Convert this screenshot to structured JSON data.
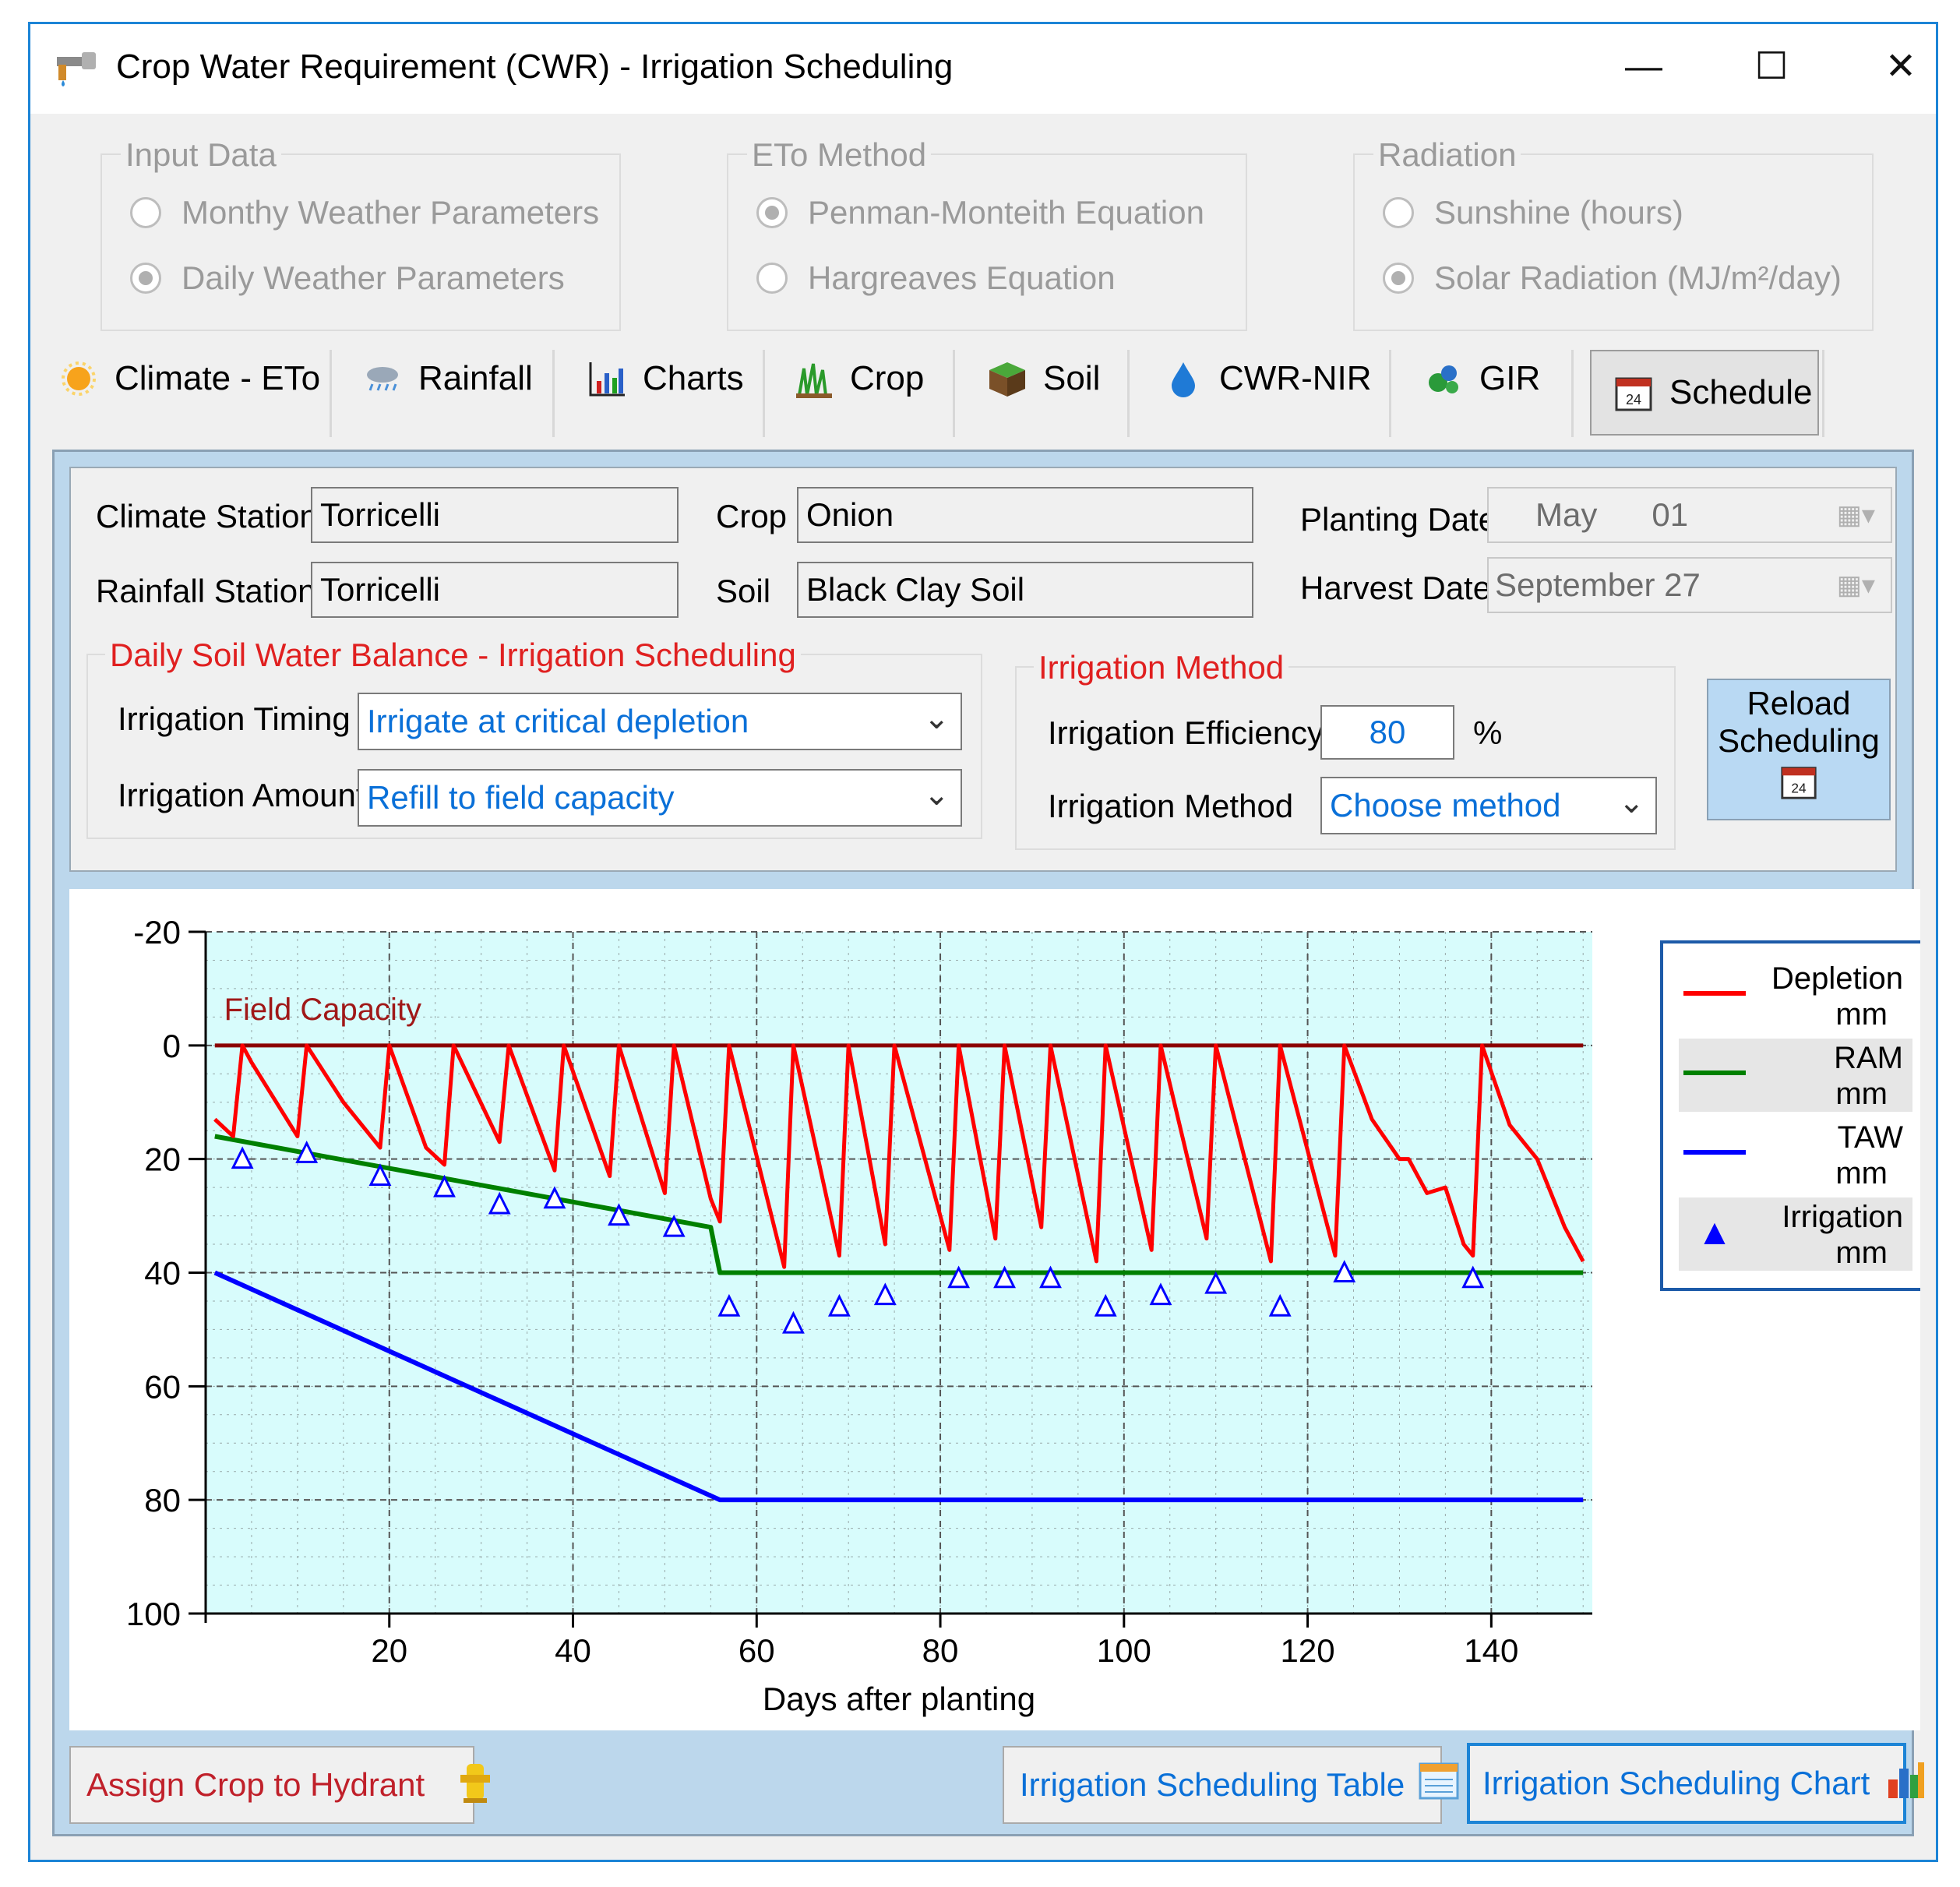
{
  "window": {
    "title": "Crop Water Requirement (CWR) - Irrigation Scheduling",
    "minimize": "—",
    "maximize": "☐",
    "close": "✕"
  },
  "input_data": {
    "label": "Input Data",
    "options": [
      "Monthy Weather Parameters",
      "Daily Weather Parameters"
    ],
    "selected": 1
  },
  "eto_method": {
    "label": "ETo Method",
    "options": [
      "Penman-Monteith Equation",
      "Hargreaves Equation"
    ],
    "selected": 0
  },
  "radiation": {
    "label": "Radiation",
    "options": [
      "Sunshine (hours)",
      "Solar Radiation (MJ/m²/day)"
    ],
    "selected": 1
  },
  "tabs": [
    {
      "label": "Climate - ETo",
      "icon": "sun-icon"
    },
    {
      "label": "Rainfall",
      "icon": "rain-icon"
    },
    {
      "label": "Charts",
      "icon": "bar-chart-icon"
    },
    {
      "label": "Crop",
      "icon": "crop-icon"
    },
    {
      "label": "Soil",
      "icon": "soil-icon"
    },
    {
      "label": "CWR-NIR",
      "icon": "water-drop-icon"
    },
    {
      "label": "GIR",
      "icon": "gir-icon"
    },
    {
      "label": "Schedule",
      "icon": "calendar-icon",
      "active": true
    }
  ],
  "info": {
    "climate_station_label": "Climate Station",
    "climate_station": "Torricelli",
    "rainfall_station_label": "Rainfall Station",
    "rainfall_station": "Torricelli",
    "crop_label": "Crop",
    "crop": "Onion",
    "soil_label": "Soil",
    "soil": "Black Clay Soil",
    "planting_date_label": "Planting Date",
    "planting_month": "May",
    "planting_day": "01",
    "harvest_date_label": "Harvest Date",
    "harvest_date": "September 27"
  },
  "balance": {
    "label": "Daily Soil Water Balance - Irrigation Scheduling",
    "timing_label": "Irrigation Timing",
    "timing_value": "Irrigate at critical depletion",
    "amount_label": "Irrigation Amount",
    "amount_value": "Refill to field capacity"
  },
  "method": {
    "label": "Irrigation Method",
    "efficiency_label": "Irrigation Efficiency",
    "efficiency_value": "80",
    "efficiency_unit": "%",
    "method_label": "Irrigation Method",
    "method_value": "Choose method"
  },
  "reload": {
    "line1": "Reload",
    "line2": "Scheduling"
  },
  "buttons": {
    "assign": "Assign Crop to Hydrant",
    "table": "Irrigation Scheduling Table",
    "chart": "Irrigation Scheduling Chart"
  },
  "colors": {
    "depletion": "#ff0000",
    "ram": "#008000",
    "taw": "#0000ff",
    "irrigation": "#0000ff",
    "field_capacity": "#8b0000",
    "plot_bg": "#d8fcfc",
    "accent": "#1c84d6"
  },
  "chart_data": {
    "type": "line",
    "xlabel": "Days after planting",
    "annotation": "Field Capacity",
    "xlim": [
      0,
      151
    ],
    "ylim": [
      -20,
      100
    ],
    "y_inverted": true,
    "xticks": [
      20,
      40,
      60,
      80,
      100,
      120,
      140
    ],
    "yticks": [
      -20,
      0,
      20,
      40,
      60,
      80,
      100
    ],
    "grid": true,
    "legend_position": "right",
    "legend": [
      {
        "name": "Depletion",
        "unit": "mm",
        "marker": "line"
      },
      {
        "name": "RAM",
        "unit": "mm",
        "marker": "line"
      },
      {
        "name": "TAW",
        "unit": "mm",
        "marker": "line"
      },
      {
        "name": "Irrigation",
        "unit": "mm",
        "marker": "triangle"
      }
    ],
    "series": [
      {
        "name": "Depletion",
        "x": [
          1,
          3,
          4,
          5,
          10,
          11,
          15,
          19,
          20,
          24,
          26,
          27,
          32,
          33,
          38,
          39,
          44,
          45,
          50,
          51,
          55,
          56,
          57,
          63,
          64,
          69,
          70,
          74,
          75,
          81,
          82,
          86,
          87,
          91,
          92,
          97,
          98,
          103,
          104,
          109,
          110,
          116,
          117,
          123,
          124,
          127,
          130,
          131,
          133,
          135,
          137,
          138,
          139,
          142,
          145,
          148,
          150
        ],
        "y": [
          13,
          16,
          0,
          3,
          16,
          0,
          10,
          18,
          0,
          18,
          21,
          0,
          17,
          0,
          22,
          0,
          23,
          0,
          26,
          0,
          27,
          31,
          0,
          39,
          0,
          37,
          0,
          35,
          0,
          36,
          0,
          34,
          0,
          32,
          0,
          38,
          0,
          36,
          0,
          34,
          0,
          38,
          0,
          37,
          0,
          13,
          20,
          20,
          26,
          25,
          35,
          37,
          0,
          14,
          20,
          32,
          38
        ]
      },
      {
        "name": "RAM",
        "x": [
          1,
          55,
          56,
          150
        ],
        "y": [
          16,
          32,
          40,
          40
        ]
      },
      {
        "name": "TAW",
        "x": [
          1,
          56,
          150
        ],
        "y": [
          40,
          80,
          80
        ]
      },
      {
        "name": "Irrigation",
        "x": [
          4,
          11,
          19,
          26,
          32,
          38,
          45,
          51,
          57,
          64,
          69,
          74,
          82,
          87,
          92,
          98,
          104,
          110,
          117,
          124,
          138
        ],
        "y": [
          20,
          19,
          23,
          25,
          28,
          27,
          30,
          32,
          46,
          49,
          46,
          44,
          41,
          41,
          41,
          46,
          44,
          42,
          46,
          40,
          41
        ]
      },
      {
        "name": "Field Capacity",
        "x": [
          1,
          150
        ],
        "y": [
          0,
          0
        ]
      }
    ]
  }
}
